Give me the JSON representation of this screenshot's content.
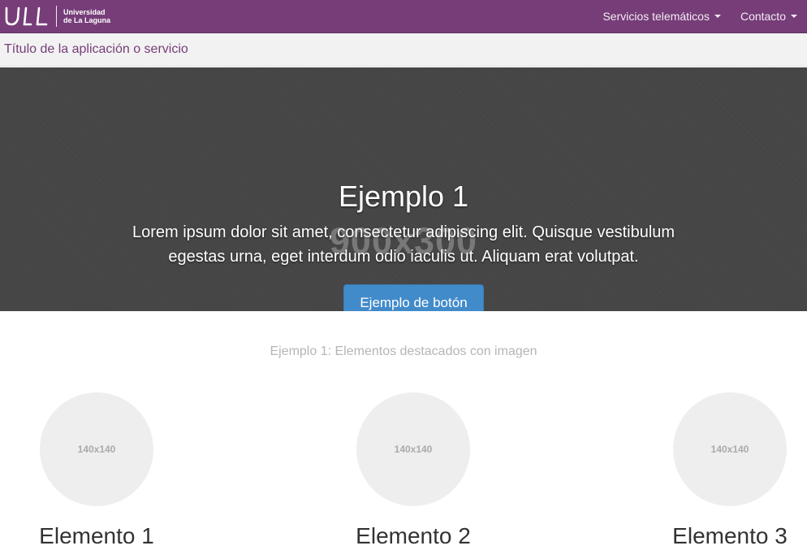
{
  "navbar": {
    "brand": {
      "logo_text": "ULL",
      "line1": "Universidad",
      "line2": "de La Laguna"
    },
    "links": [
      {
        "label": "Servicios telemáticos"
      },
      {
        "label": "Contacto"
      }
    ]
  },
  "subheader": {
    "title": "Título de la aplicación o servicio"
  },
  "carousel": {
    "image_placeholder": "900x300",
    "title": "Ejemplo 1",
    "text": "Lorem ipsum dolor sit amet, consectetur adipiscing elit. Quisque vestibulum egestas urna, eget interdum odio iaculis ut. Aliquam erat volutpat.",
    "button_label": "Ejemplo de botón",
    "indicators": 3,
    "active_index": 0
  },
  "featured": {
    "section_title": "Ejemplo 1: Elementos destacados con imagen",
    "items": [
      {
        "image_placeholder": "140x140",
        "title": "Elemento 1"
      },
      {
        "image_placeholder": "140x140",
        "title": "Elemento 2"
      },
      {
        "image_placeholder": "140x140",
        "title": "Elemento 3"
      }
    ]
  },
  "colors": {
    "brand_purple": "#763d78",
    "primary_button": "#428bca",
    "carousel_bg": "#444444",
    "placeholder_bg": "#eeeeee"
  },
  "icons": [
    "caret-down-icon",
    "ull-logo-icon"
  ]
}
